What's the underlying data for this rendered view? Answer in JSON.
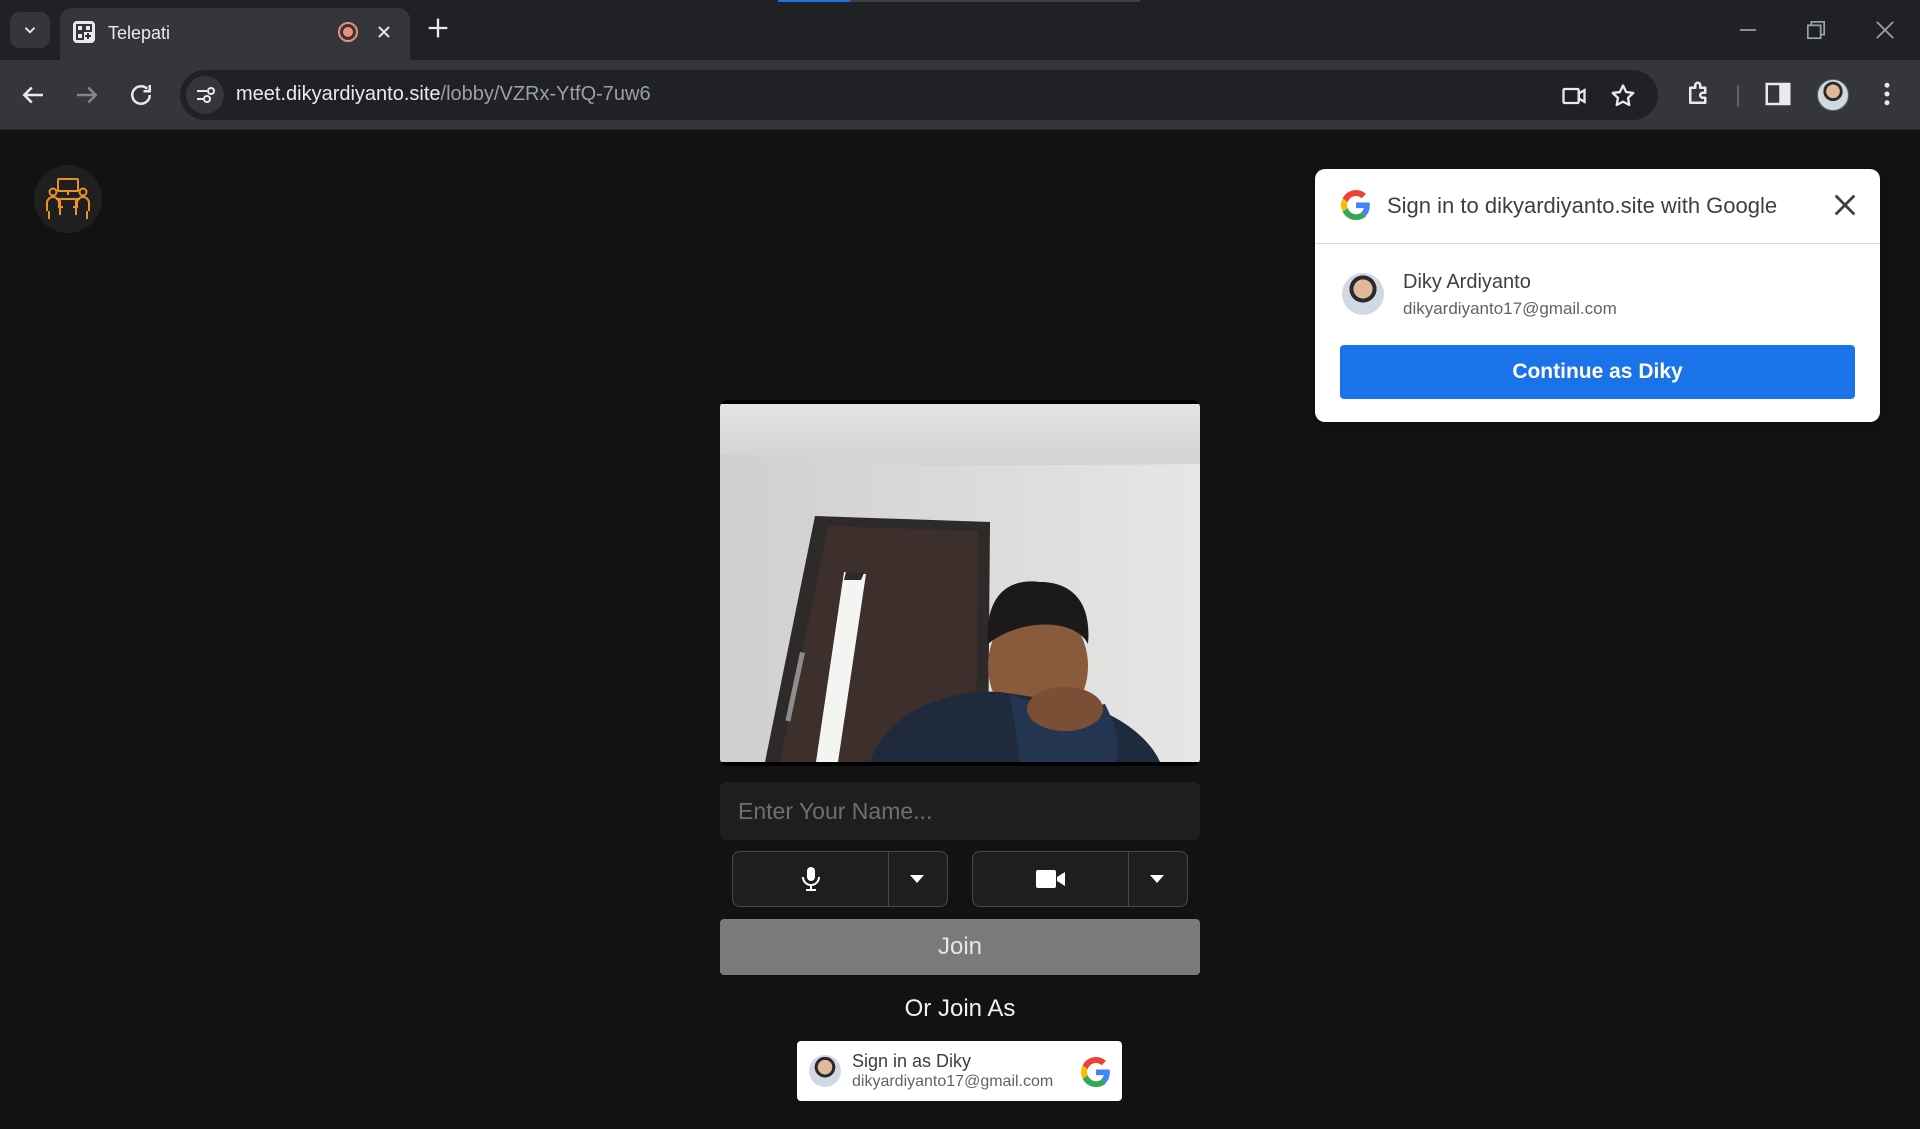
{
  "browser": {
    "tab_title": "Telepati",
    "url_host": "meet.dikyardiyanto.site",
    "url_path": "/lobby/VZRx-YtfQ-7uw6"
  },
  "page": {
    "name_placeholder": "Enter Your Name...",
    "join_label": "Join",
    "or_join_as": "Or Join As",
    "mic_icon": "microphone-icon",
    "camera_icon": "video-camera-icon"
  },
  "gsi_button": {
    "label": "Sign in as Diky",
    "email": "dikyardiyanto17@gmail.com"
  },
  "onetap": {
    "title": "Sign in to dikyardiyanto.site with Google",
    "account_name": "Diky Ardiyanto",
    "account_email": "dikyardiyanto17@gmail.com",
    "continue_label": "Continue as Diky"
  },
  "colors": {
    "google_blue": "#1a73e8",
    "logo_accent": "#e8912d",
    "page_bg": "#121212"
  }
}
